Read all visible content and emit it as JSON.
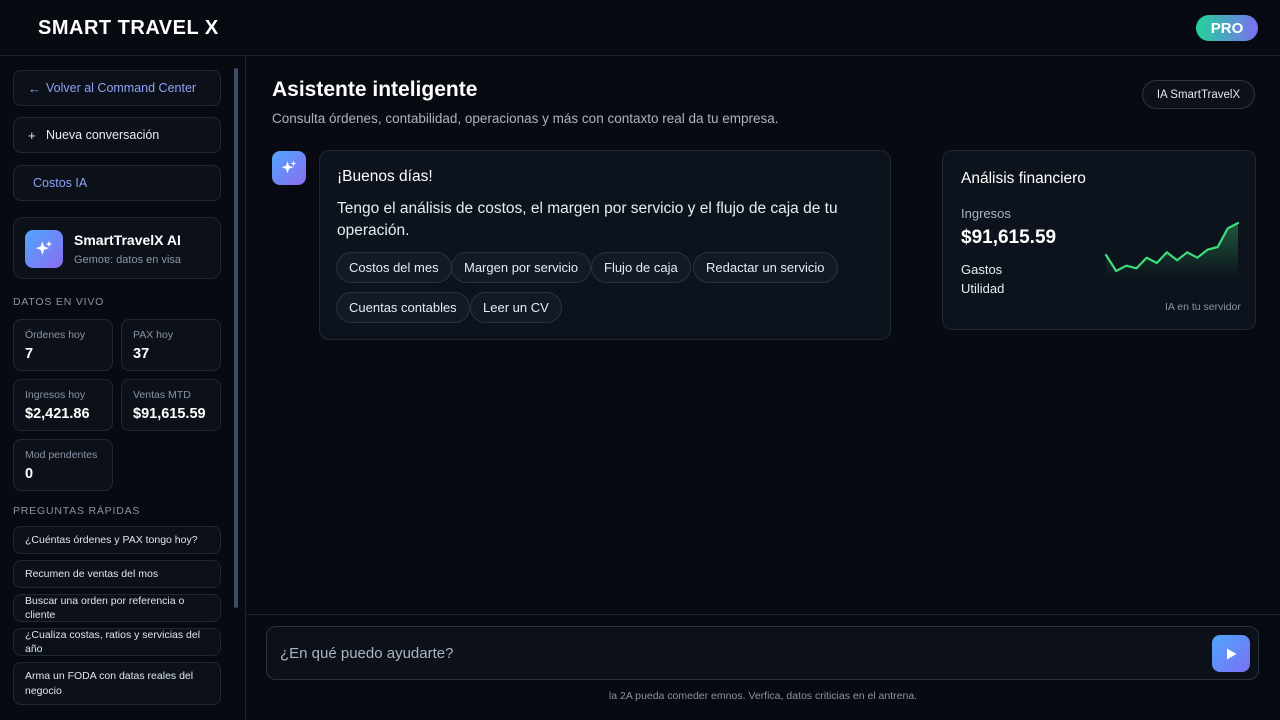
{
  "header": {
    "brand": "SMART TRAVEL X",
    "badge": "PRO"
  },
  "sidebar": {
    "back_label": "Volver al Command Center",
    "new_label": "Nueva conversación",
    "costos_label": "Costos IA",
    "ai_card": {
      "title": "SmartTravelX AI",
      "subtitle": "Gemoɐ: datos en visa"
    },
    "live_section": "DATOS EN VIVO",
    "stats": [
      {
        "label": "Órdenes hoy",
        "value": "7"
      },
      {
        "label": "PAX hoy",
        "value": "37"
      },
      {
        "label": "Ingresos hoy",
        "value": "$2,421.86"
      },
      {
        "label": "Ventas MTD",
        "value": "$91,615.59"
      },
      {
        "label": "Mod pendentes",
        "value": "0"
      }
    ],
    "quick_section": "PREGUNTAS RÁPIDAS",
    "quick": [
      "¿Cuéntas órdenes y PAX tongo hoy?",
      "Recumen de ventas del mos",
      "Buscar una orden por referencia o cliente",
      "¿Cualiza costas, ratios y servicias del año",
      "Arma un FODA con datas reales del negocio"
    ]
  },
  "main": {
    "title": "Asistente inteligente",
    "subtitle": "Consulta órdenes, contabilidad, operacionas y más con contaxto real da tu empresa.",
    "ia_badge": "IA SmartTravelX",
    "greeting": "¡Buenos días!",
    "message": "Tengo el análisis de costos, el margen por servicio y el flujo de caja de tu operación.",
    "chips": [
      "Costos del mes",
      "Margen por servicio",
      "Flujo de caja",
      "Redactar un servicio",
      "Cuentas contables",
      "Leer un CV"
    ]
  },
  "finance": {
    "title": "Análisis financiero",
    "ingresos_label": "Ingresos",
    "ingresos_value": "$91,615.59",
    "gastos_label": "Gastos",
    "utilidad_label": "Utilidad",
    "footer": "IA en tu servidor",
    "trend_color": "#3ddc7a",
    "chart_data": {
      "type": "line",
      "series": [
        {
          "values": [
            8,
            2,
            4,
            3,
            7,
            5,
            9,
            6,
            9,
            7,
            10,
            11,
            18,
            20
          ]
        }
      ]
    }
  },
  "composer": {
    "placeholder": "¿En qué puedo ayudarte?",
    "disclaimer": "la 2A pueda comeder emnos. Verfica, datos criticias en el antrena."
  },
  "colors": {
    "background": "#070a10",
    "accent": "#8fa2f5",
    "gradient_start": "#4fa6ff",
    "gradient_end": "#7b6ff2"
  }
}
